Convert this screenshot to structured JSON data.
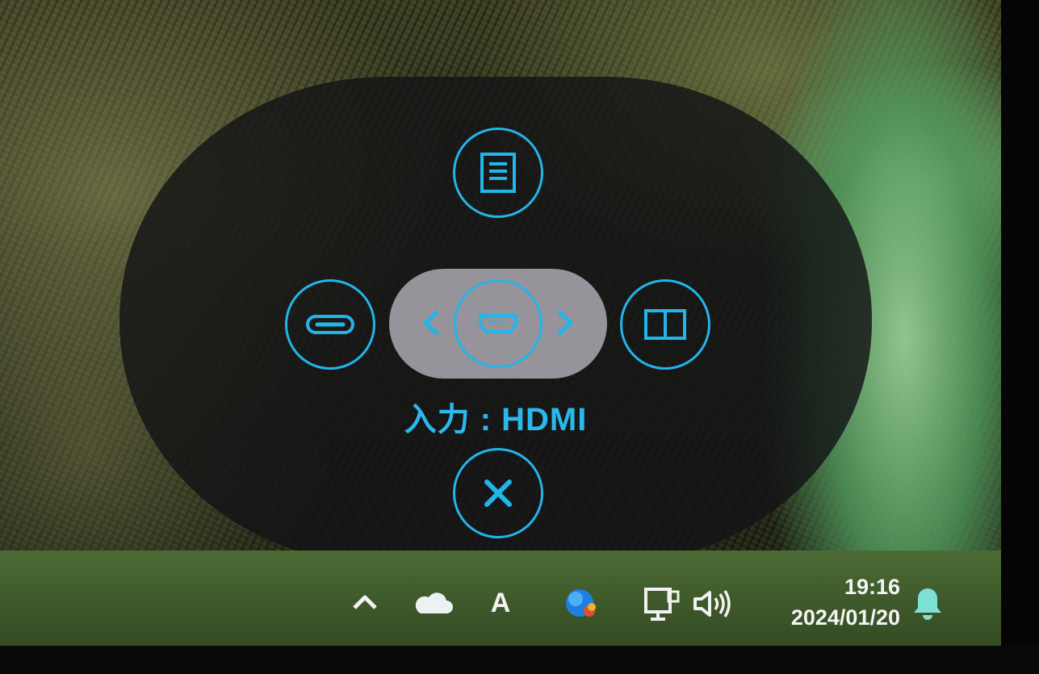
{
  "osd": {
    "input_label": "入力 : HDMI",
    "buttons": {
      "menu": "menu-icon",
      "usbc": "usb-c-port-icon",
      "hdmi": "hdmi-port-icon",
      "pbp": "split-screen-icon",
      "close": "close-icon"
    },
    "accent_color": "#22b5ea"
  },
  "taskbar": {
    "ime_label": "A",
    "time": "19:16",
    "date": "2024/01/20",
    "icons": [
      "chevron-up-icon",
      "onedrive-cloud-icon",
      "copilot-icon",
      "network-icon",
      "volume-icon",
      "notification-bell-icon"
    ]
  }
}
